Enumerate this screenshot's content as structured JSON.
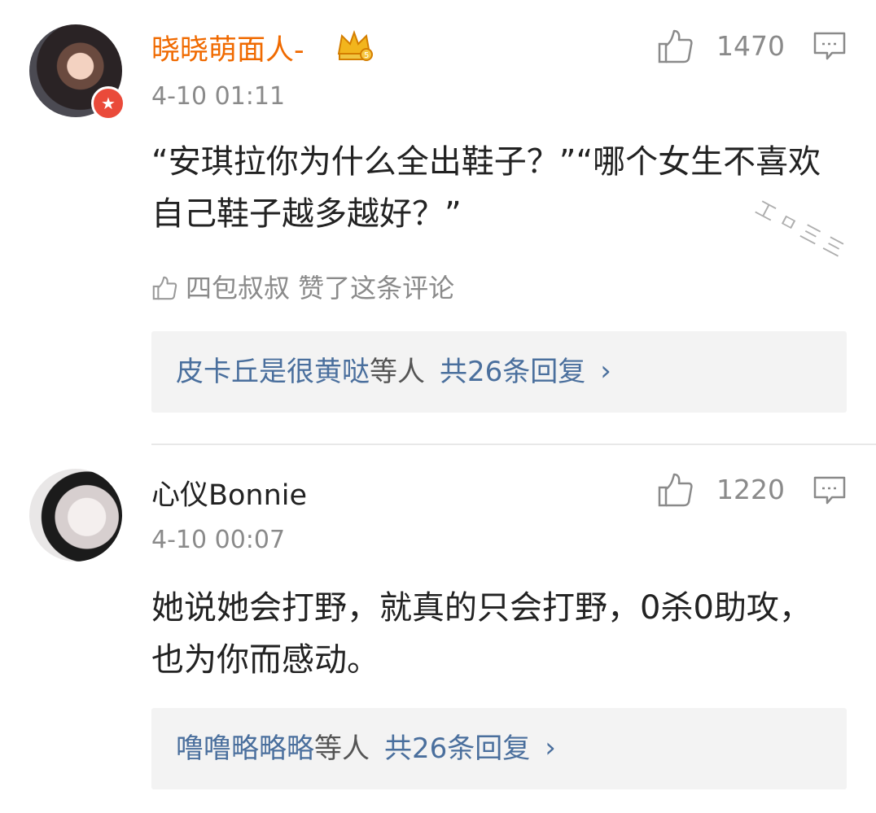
{
  "comments": [
    {
      "username": "晓晓萌面人-",
      "timestamp": "4-10 01:11",
      "likes": "1470",
      "content": "“安琪拉你为什么全出鞋子？”“哪个女生不喜欢自己鞋子越多越好？”",
      "liked_by": "四包叔叔 赞了这条评论",
      "replies": {
        "names": "皮卡丘是很黄哒",
        "etc": "等人",
        "total": "共26条回复",
        "chevron": "›"
      }
    },
    {
      "username": "心仪Bonnie",
      "timestamp": "4-10 00:07",
      "likes": "1220",
      "content": "她说她会打野，就真的只会打野，0杀0助攻，也为你而感动。",
      "replies": {
        "names": "噜噜略略略",
        "etc": "等人",
        "total": "共26条回复",
        "chevron": "›"
      }
    }
  ],
  "watermark": "工ㅁ三三",
  "colors": {
    "username_highlight": "#f06a00",
    "meta_gray": "#8a8a8a",
    "reply_link": "#4a6f9d",
    "reply_box_bg": "#f3f3f3"
  },
  "icons": {
    "like": "thumbs-up-icon",
    "reply": "comment-icon",
    "crown": "crown-badge-icon",
    "verified": "verified-star-icon"
  }
}
